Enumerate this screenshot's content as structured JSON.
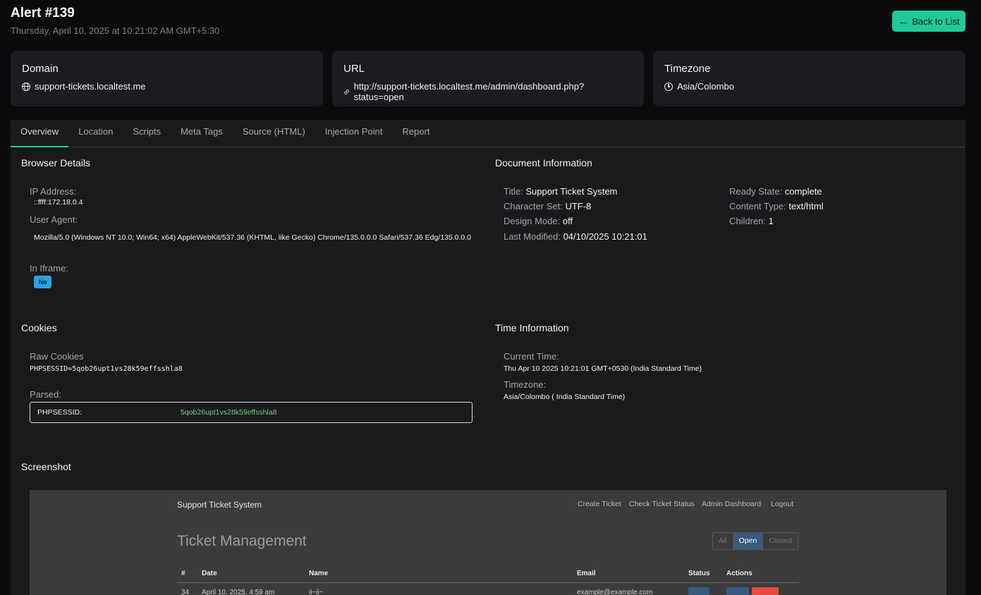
{
  "header": {
    "title": "Alert #139",
    "subtitle": "Thursday, April 10, 2025 at 10:21:02 AM GMT+5:30",
    "back_label": "Back to List"
  },
  "cards": {
    "domain": {
      "label": "Domain",
      "value": "support-tickets.localtest.me"
    },
    "url": {
      "label": "URL",
      "value": "http://support-tickets.localtest.me/admin/dashboard.php?status=open"
    },
    "timezone": {
      "label": "Timezone",
      "value": "Asia/Colombo"
    }
  },
  "tabs": [
    "Overview",
    "Location",
    "Scripts",
    "Meta Tags",
    "Source (HTML)",
    "Injection Point",
    "Report"
  ],
  "browser": {
    "heading": "Browser Details",
    "ip_label": "IP Address:",
    "ip_value": "::ffff:172.18.0.4",
    "ua_label": "User Agent:",
    "ua_value": "Mozilla/5.0 (Windows NT 10.0; Win64; x64) AppleWebKit/537.36 (KHTML, like Gecko) Chrome/135.0.0.0 Safari/537.36 Edg/135.0.0.0",
    "iframe_label": "In Iframe:",
    "iframe_value": "No"
  },
  "document": {
    "heading": "Document Information",
    "title_label": "Title:",
    "title_value": "Support Ticket System",
    "charset_label": "Character Set:",
    "charset_value": "UTF-8",
    "design_label": "Design Mode:",
    "design_value": "off",
    "modified_label": "Last Modified:",
    "modified_value": "04/10/2025 10:21:01",
    "ready_label": "Ready State:",
    "ready_value": "complete",
    "ctype_label": "Content Type:",
    "ctype_value": "text/html",
    "children_label": "Children:",
    "children_value": "1"
  },
  "cookies": {
    "heading": "Cookies",
    "raw_label": "Raw Cookies",
    "raw_value": "PHPSESSID=5qob26upt1vs28k59effsshla8",
    "parsed_label": "Parsed:",
    "parsed_key": "PHPSESSID:",
    "parsed_value": "5qob26upt1vs28k59effsshla8"
  },
  "time": {
    "heading": "Time Information",
    "current_label": "Current Time:",
    "current_value": "Thu Apr 10 2025 10:21:01 GMT+0530 (India Standard Time)",
    "tz_label": "Timezone:",
    "tz_value": "Asia/Colombo ( India Standard Time)"
  },
  "screenshot": {
    "heading": "Screenshot",
    "brand": "Support Ticket System",
    "nav": [
      "Create Ticket",
      "Check Ticket Status",
      "Admin Dashboard",
      "Logout"
    ],
    "page_title": "Ticket Management",
    "filters": [
      "All",
      "Open",
      "Closed"
    ],
    "active_filter": "Open",
    "columns": [
      "#",
      "Date",
      "Name",
      "Email",
      "Status",
      "Actions"
    ],
    "row_partial": [
      "34",
      "April 10, 2025, 4:59 am",
      "ii~ii~",
      "example@example.com"
    ]
  },
  "colors": {
    "accent": "#20c997",
    "badge": "#2ba3e3",
    "cookie_value": "#6fd57e"
  }
}
